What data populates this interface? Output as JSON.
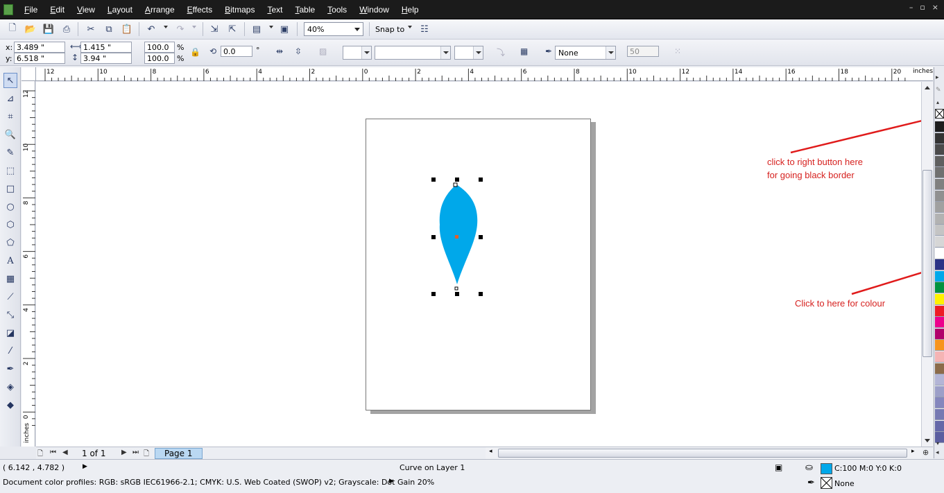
{
  "menubar": {
    "items": [
      "File",
      "Edit",
      "View",
      "Layout",
      "Arrange",
      "Effects",
      "Bitmaps",
      "Text",
      "Table",
      "Tools",
      "Window",
      "Help"
    ],
    "window_controls": [
      "–",
      "▫",
      "×"
    ]
  },
  "toolbar": {
    "zoom_level": "40%",
    "snap_to_label": "Snap to"
  },
  "propbar": {
    "x_label": "x:",
    "x_value": "3.489 \"",
    "y_label": "y:",
    "y_value": "6.518 \"",
    "width_value": "1.415 \"",
    "height_value": "3.94 \"",
    "scale_x": "100.0",
    "scale_y": "100.0",
    "percent": "%",
    "rotation": "0.0",
    "degree": "°",
    "outline_width": "None",
    "nib_value": "50"
  },
  "rulers": {
    "h_labels": [
      "12",
      "10",
      "8",
      "6",
      "4",
      "2",
      "0",
      "2",
      "4",
      "6",
      "8",
      "10",
      "12",
      "14",
      "16",
      "18",
      "20"
    ],
    "v_labels": [
      "12",
      "10",
      "8",
      "6",
      "4",
      "2",
      "0"
    ],
    "unit": "inches"
  },
  "annotations": {
    "right_click_line1": "click to right button here",
    "right_click_line2": "for going black border",
    "colour": "Click to here for colour"
  },
  "palette": {
    "colors": [
      "#1e1e1e",
      "#333333",
      "#4a4a4a",
      "#5f5f5f",
      "#707070",
      "#808080",
      "#909090",
      "#a0a0a0",
      "#b2b2b2",
      "#c4c4c4",
      "#d6d6d6",
      "#ffffff",
      "#2b3386",
      "#00a8ea",
      "#00923f",
      "#fff200",
      "#ed1c24",
      "#ec008c",
      "#b0006a",
      "#f7941d",
      "#f5b4b4",
      "#8b6b4a",
      "#b3b5d6",
      "#9c9fc8",
      "#8587bd",
      "#7679b2",
      "#6568a8",
      "#5b5ea0"
    ]
  },
  "navbar": {
    "page_count": "1 of 1",
    "page_tab": "Page 1"
  },
  "status": {
    "coords": "( 6.142 , 4.782 )",
    "object_info": "Curve on Layer 1",
    "color_profiles": "Document color profiles: RGB: sRGB IEC61966-2.1; CMYK: U.S. Web Coated (SWOP) v2; Grayscale: Dot Gain 20%",
    "fill_value": "C:100 M:0 Y:0 K:0",
    "outline_value": "None",
    "fill_color": "#00a8ea"
  },
  "shape": {
    "fill_color": "#00a8ea",
    "center_marker_color": "#e0602a"
  },
  "accent": {
    "annotation_color": "#d6211f"
  }
}
